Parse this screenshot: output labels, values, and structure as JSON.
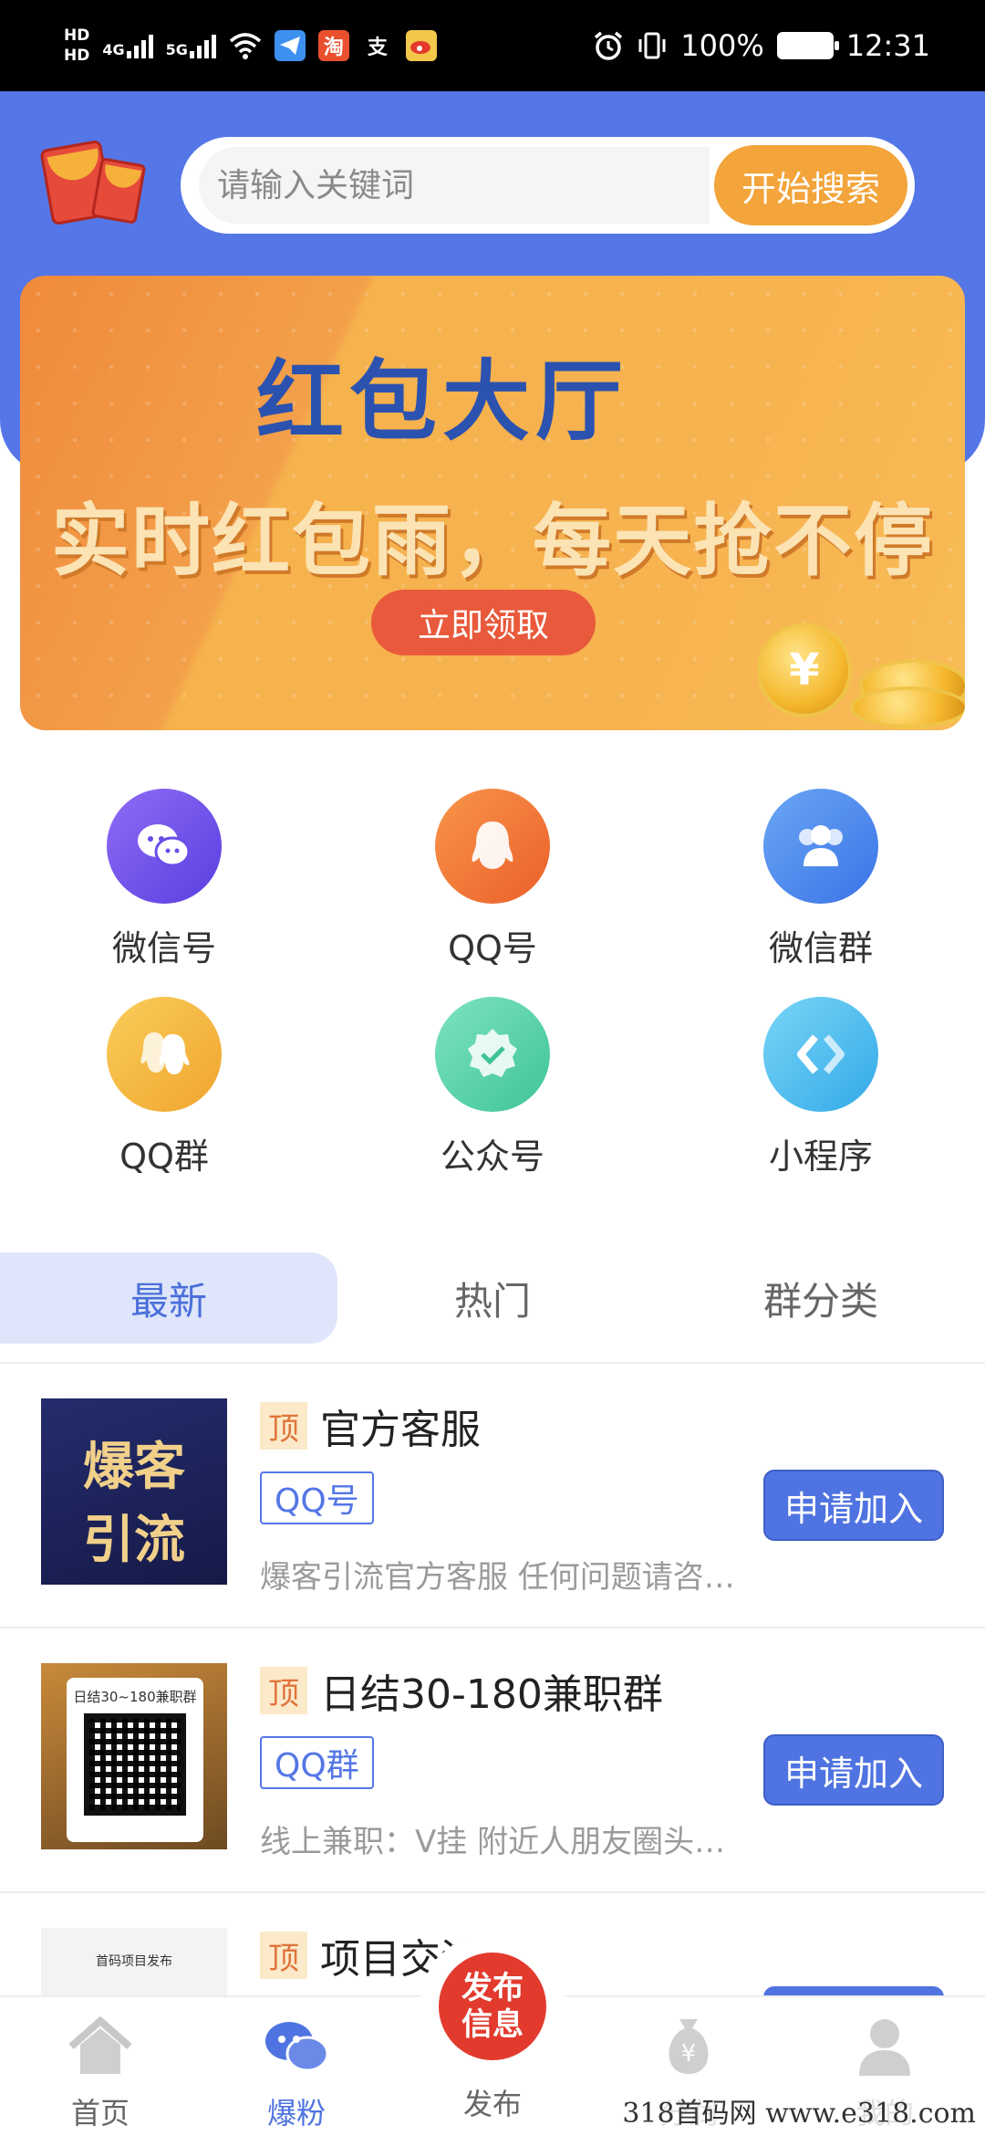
{
  "status_bar": {
    "hd1": "HD",
    "hd2": "HD",
    "net1": "4G",
    "net2": "5G",
    "battery": "100%",
    "time": "12:31",
    "app_taobao": "淘",
    "app_alipay": "支"
  },
  "search": {
    "placeholder": "请输入关键词",
    "button": "开始搜索"
  },
  "banner": {
    "title": "红包大厅",
    "subtitle": "实时红包雨，每天抢不停",
    "button": "立即领取",
    "coin_symbol": "¥"
  },
  "categories": [
    {
      "label": "微信号",
      "icon": "wechat-icon",
      "color": "#6a4ee8"
    },
    {
      "label": "QQ号",
      "icon": "qq-icon",
      "color": "#f07a35"
    },
    {
      "label": "微信群",
      "icon": "group-icon",
      "color": "#4a86ee"
    },
    {
      "label": "QQ群",
      "icon": "qq-group-icon",
      "color": "#f3b23e"
    },
    {
      "label": "公众号",
      "icon": "verified-icon",
      "color": "#4fd1a5"
    },
    {
      "label": "小程序",
      "icon": "mini-program-icon",
      "color": "#4ac1ee"
    }
  ],
  "tabs": [
    "最新",
    "热门",
    "群分类"
  ],
  "list": [
    {
      "top": "顶",
      "title": "官方客服",
      "tag": "QQ号",
      "desc": "爆客引流官方客服 任何问题请咨…",
      "action": "申请加入",
      "thumb_text_1": "爆客",
      "thumb_text_2": "引流"
    },
    {
      "top": "顶",
      "title": "日结30-180兼职群",
      "tag": "QQ群",
      "desc": "线上兼职：V挂 附近人朋友圈头…",
      "action": "申请加入",
      "thumb_text_1": "日结30~180兼职群"
    },
    {
      "top": "顶",
      "title": "项目交流群",
      "thumb_text_1": "首码项目发布"
    }
  ],
  "nav": {
    "home": "首页",
    "fans": "爆粉",
    "publish": "发布",
    "publish_badge": "发布信息",
    "share": "分润",
    "mine": "我的",
    "share_symbol": "¥"
  },
  "watermark": "318首码网  www.e318.com",
  "colors": {
    "header_blue": "#5476e6",
    "accent_orange": "#f3a43a",
    "button_blue": "#4f73e0",
    "publish_red": "#e23b2e"
  }
}
